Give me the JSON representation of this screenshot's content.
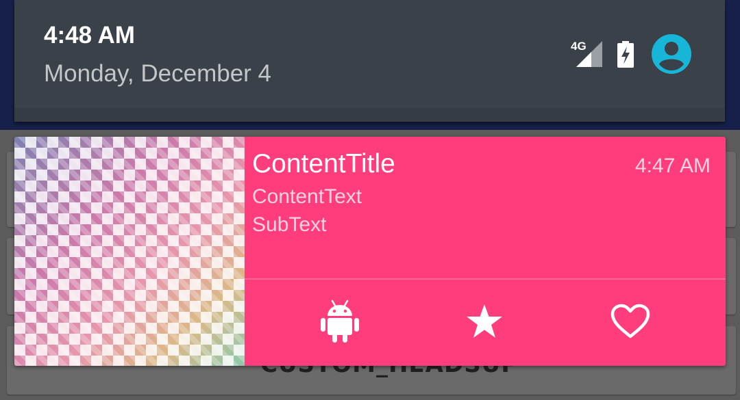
{
  "status_bar": {
    "time": "4:48 AM",
    "date": "Monday, December 4",
    "network_label": "4G",
    "icons": [
      "signal-icon",
      "battery-charging-icon",
      "user-avatar-icon"
    ],
    "accent_color": "#17b6d8"
  },
  "background_app": {
    "partial_label": "CUSTOM_HEADSUP"
  },
  "notification": {
    "content_title": "ContentTitle",
    "content_text": "ContentText",
    "sub_text": "SubText",
    "time": "4:47 AM",
    "background_color": "#ff3d7c",
    "actions": [
      {
        "icon": "android-icon"
      },
      {
        "icon": "star-icon"
      },
      {
        "icon": "heart-icon"
      }
    ]
  }
}
